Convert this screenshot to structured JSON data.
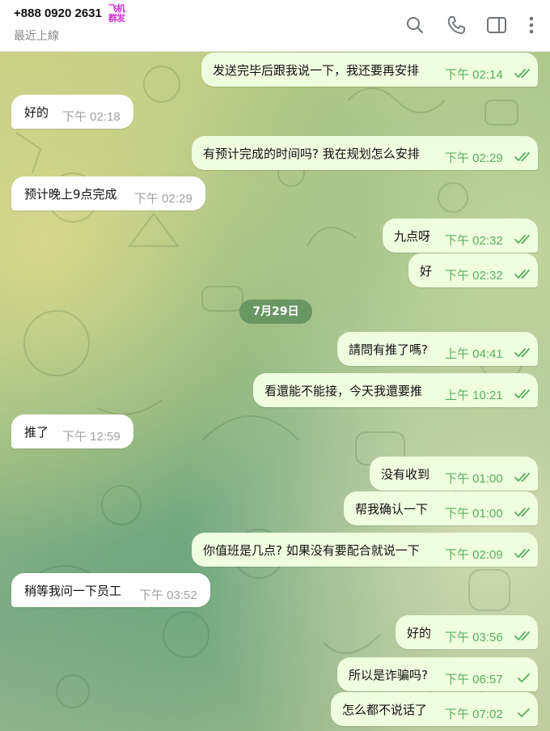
{
  "header": {
    "contact_name": "+888 0920 2631",
    "badge_line1": "飞机",
    "badge_line2": "群发",
    "last_seen": "最近上線"
  },
  "date_separator": "7月29日",
  "messages": [
    {
      "dir": "out",
      "text": "发送完毕后跟我说一下，我还要再安排",
      "time": "下午 02:14",
      "status": "read"
    },
    {
      "dir": "in",
      "text": "好的",
      "time": "下午 02:18"
    },
    {
      "dir": "out",
      "text": "有预计完成的时间吗? 我在规划怎么安排",
      "time": "下午 02:29",
      "status": "read"
    },
    {
      "dir": "in",
      "text": "预计晚上9点完成",
      "time": "下午 02:29"
    },
    {
      "dir": "out",
      "text": "九点呀",
      "time": "下午 02:32",
      "status": "read"
    },
    {
      "dir": "out",
      "text": "好",
      "time": "下午 02:32",
      "status": "read"
    },
    {
      "dir": "out",
      "text": "請問有推了嗎?",
      "time": "上午 04:41",
      "status": "read"
    },
    {
      "dir": "out",
      "text": "看還能不能接，今天我還要推",
      "time": "上午 10:21",
      "status": "read"
    },
    {
      "dir": "in",
      "text": "推了",
      "time": "下午 12:59"
    },
    {
      "dir": "out",
      "text": "没有收到",
      "time": "下午 01:00",
      "status": "read"
    },
    {
      "dir": "out",
      "text": "帮我确认一下",
      "time": "下午 01:00",
      "status": "read"
    },
    {
      "dir": "out",
      "text": "你值班是几点? 如果没有要配合就说一下",
      "time": "下午 02:09",
      "status": "read"
    },
    {
      "dir": "in",
      "text": "稍等我问一下员工",
      "time": "下午 03:52"
    },
    {
      "dir": "out",
      "text": "好的",
      "time": "下午 03:56",
      "status": "read"
    },
    {
      "dir": "out",
      "text": "所以是诈骗吗?",
      "time": "下午 06:57",
      "status": "sent"
    },
    {
      "dir": "out",
      "text": "怎么都不说话了",
      "time": "下午 07:02",
      "status": "sent"
    }
  ],
  "colors": {
    "incoming_bubble": "#ffffff",
    "outgoing_bubble": "#eefedf",
    "outgoing_time": "#5cae5f",
    "incoming_time": "#a0a0a0",
    "badge": "#d02bd6",
    "date_chip": "#5d8c5c"
  },
  "icons": {
    "search": "search-icon",
    "call": "phone-icon",
    "sidebar": "sidebar-toggle-icon",
    "menu": "more-vertical-icon"
  }
}
